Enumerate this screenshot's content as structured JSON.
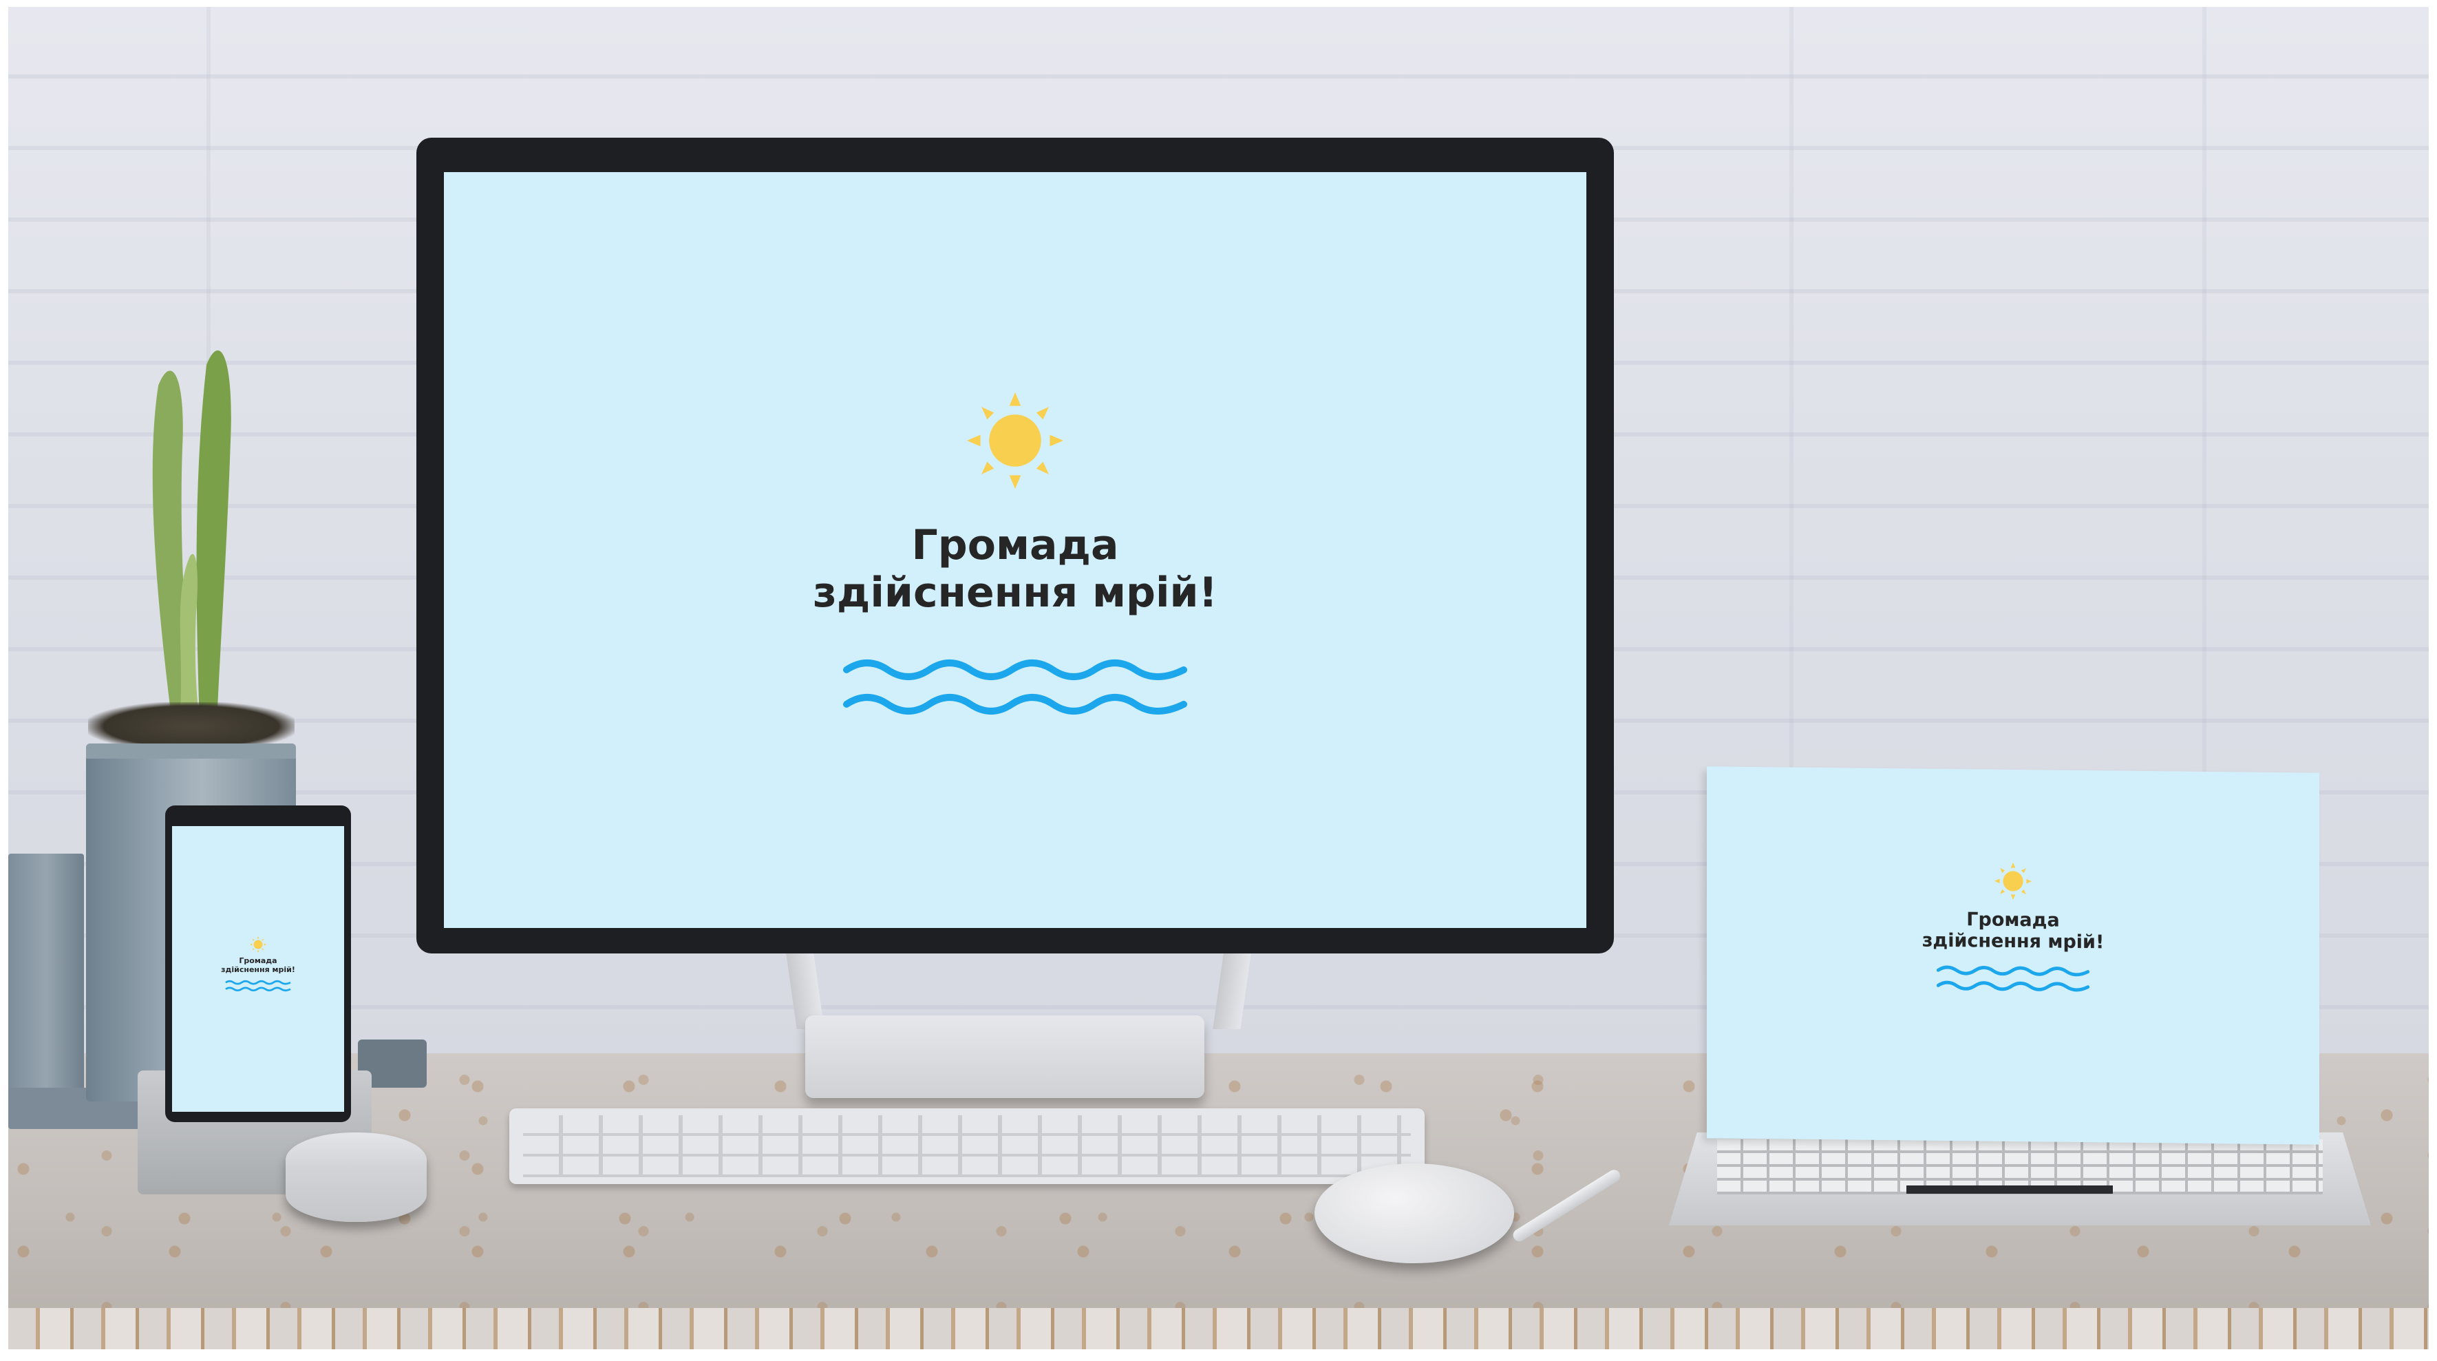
{
  "monitor_screen": {
    "title_line1": "Громада",
    "title_line2": "здійснення мрій!",
    "sun_icon": "sun-icon",
    "waves_icon": "waves-icon"
  },
  "laptop_screen": {
    "title_line1": "Громада",
    "title_line2": "здійснення мрій!",
    "sun_icon": "sun-icon",
    "waves_icon": "waves-icon"
  },
  "phone_screen": {
    "title_line1": "Громада",
    "title_line2": "здійснення мрій!",
    "sun_icon": "sun-icon",
    "waves_icon": "waves-icon"
  },
  "colors": {
    "screen_background": "#d2f0fc",
    "sun": "#f9cf4f",
    "waves": "#1ca7ec",
    "text": "#262626"
  }
}
